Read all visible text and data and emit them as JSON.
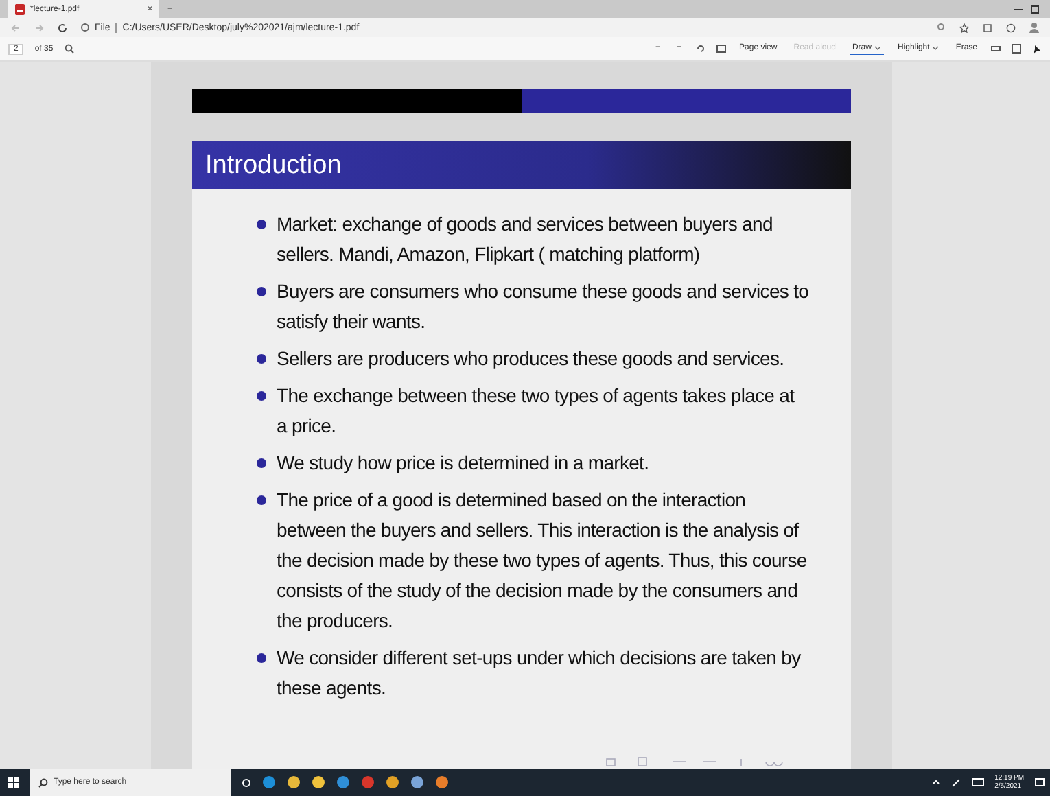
{
  "tab": {
    "title": "*lecture-1.pdf",
    "close": "×",
    "new": "+"
  },
  "address": {
    "prefix": "File",
    "url": "C:/Users/USER/Desktop/july%202021/ajm/lecture-1.pdf"
  },
  "pdf_toolbar": {
    "page": "2",
    "of": "of 35",
    "zoom_out": "−",
    "zoom_in": "+",
    "page_view": "Page view",
    "read_aloud": "Read aloud",
    "tools": [
      {
        "label": "Draw",
        "selected": true
      },
      {
        "label": "Highlight",
        "selected": false
      }
    ],
    "erase": "Erase"
  },
  "slide": {
    "title": "Introduction",
    "bullets": [
      "Market: exchange of goods and services between buyers and sellers. Mandi, Amazon, Flipkart ( matching platform)",
      "Buyers are consumers who consume these goods and services to satisfy their wants.",
      "Sellers are producers who produces these goods and services.",
      "The exchange between these two types of agents takes place at a price.",
      "We study how price is determined in a market.",
      "The price of a good is determined based on the interaction between the buyers and sellers. This interaction is the analysis of the decision made by these two types of agents. Thus, this course consists of the study of the decision made by the consumers and the producers.",
      "We consider different set-ups under which decisions are taken by these agents."
    ]
  },
  "taskbar": {
    "search_placeholder": "Type here to search",
    "time": "12:19 PM",
    "date": "2/5/2021"
  }
}
